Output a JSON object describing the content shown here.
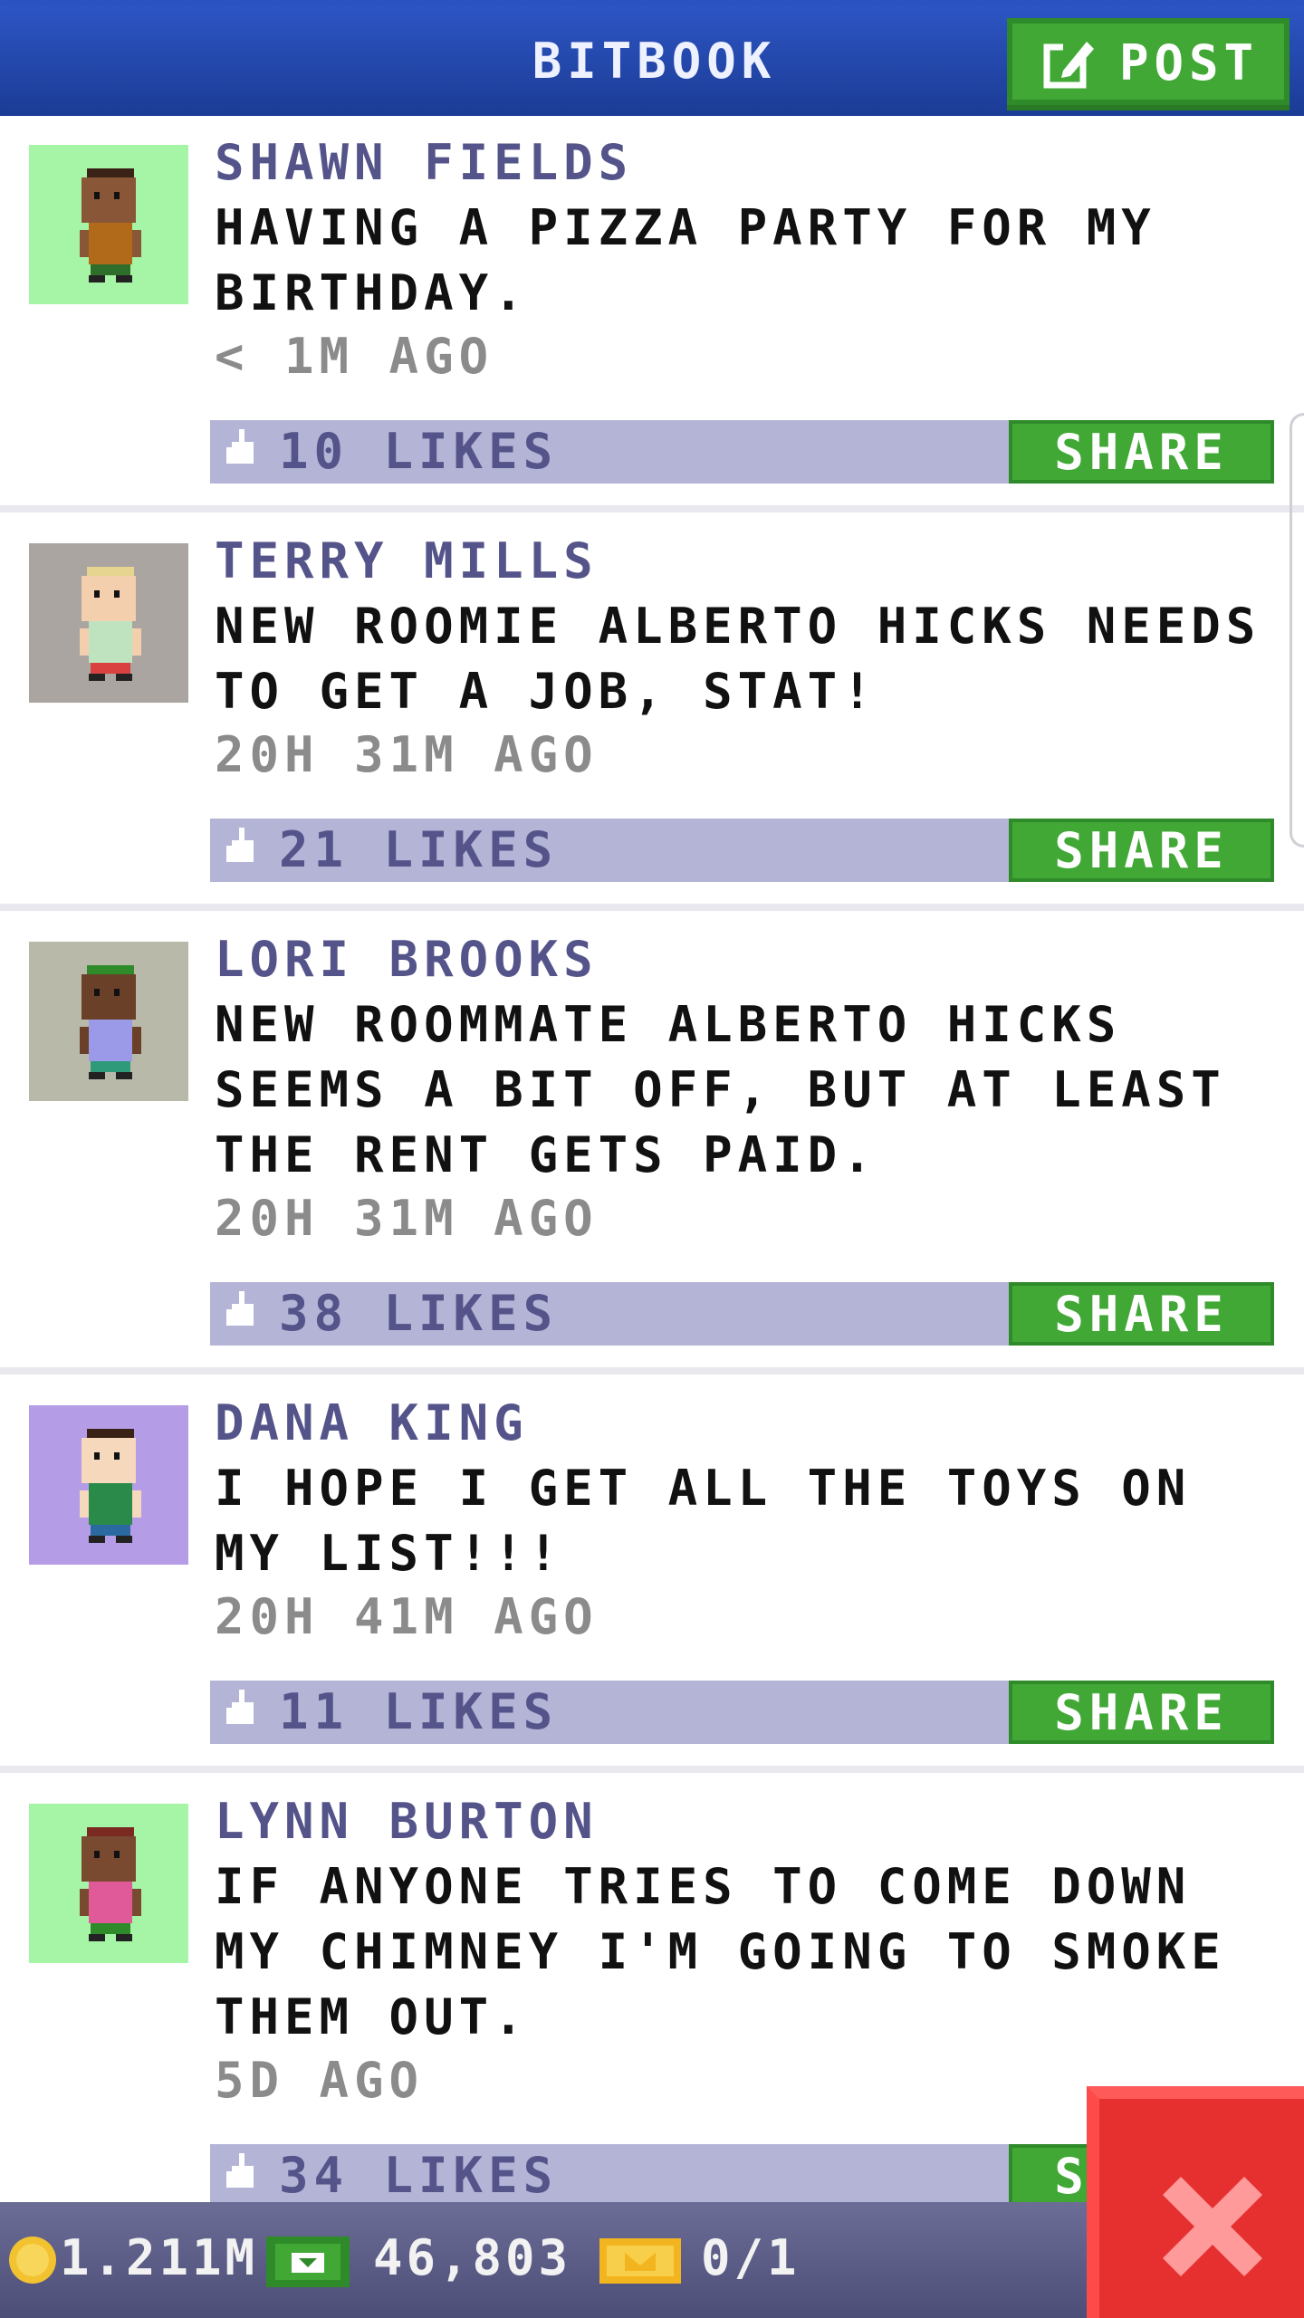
{
  "header": {
    "title": "BITBOOK",
    "post_label": "POST",
    "post_icon": "edit-icon"
  },
  "feed": [
    {
      "name": "SHAWN FIELDS",
      "message": "HAVING A PIZZA PARTY FOR MY BIRTHDAY.",
      "time": "< 1M AGO",
      "likes": "10 LIKES",
      "share": "SHARE",
      "avatar_bg": "#a6f5a6",
      "skin": "#8a5638",
      "hair": "#3b2216",
      "shirt": "#b06a1a",
      "pants": "#2f6d2a"
    },
    {
      "name": "TERRY MILLS",
      "message": "NEW ROOMIE ALBERTO HICKS NEEDS TO GET A JOB, STAT!",
      "time": "20H 31M AGO",
      "likes": "21 LIKES",
      "share": "SHARE",
      "avatar_bg": "#aaa5a0",
      "skin": "#f3cfae",
      "hair": "#e5d590",
      "shirt": "#bfe3bf",
      "pants": "#d94040"
    },
    {
      "name": "LORI BROOKS",
      "message": "NEW ROOMMATE ALBERTO HICKS SEEMS A BIT OFF, BUT AT LEAST THE RENT GETS PAID.",
      "time": "20H 31M AGO",
      "likes": "38 LIKES",
      "share": "SHARE",
      "avatar_bg": "#b9b9aa",
      "skin": "#6a4028",
      "hair": "#2f8a2a",
      "shirt": "#9a9ae8",
      "pants": "#2e9a7a"
    },
    {
      "name": "DANA KING",
      "message": "I HOPE I GET ALL THE TOYS ON MY LIST!!!",
      "time": "20H 41M AGO",
      "likes": "11 LIKES",
      "share": "SHARE",
      "avatar_bg": "#b59ce6",
      "skin": "#f6d8bd",
      "hair": "#3b2216",
      "shirt": "#2a8a4a",
      "pants": "#2a6aa0"
    },
    {
      "name": "LYNN BURTON",
      "message": "IF ANYONE TRIES TO COME DOWN MY CHIMNEY I'M GOING TO SMOKE THEM OUT.",
      "time": "5D AGO",
      "likes": "34 LIKES",
      "share": "SHARE",
      "avatar_bg": "#a6f5a6",
      "skin": "#7a4a30",
      "hair": "#7a2a20",
      "shirt": "#e05a9a",
      "pants": "#2f8a2a"
    }
  ],
  "status": {
    "coins": "1.211M",
    "cash": "46,803",
    "tickets": "0/1",
    "coin_icon": "coin-icon",
    "cash_icon": "bux-icon",
    "ticket_icon": "vip-ticket-icon"
  },
  "close_icon": "close-icon",
  "colors": {
    "header_blue": "#1f45aa",
    "button_green": "#41a836",
    "likes_bar": "#b4b4d6",
    "name_purple": "#55548a",
    "close_red": "#e63030"
  }
}
